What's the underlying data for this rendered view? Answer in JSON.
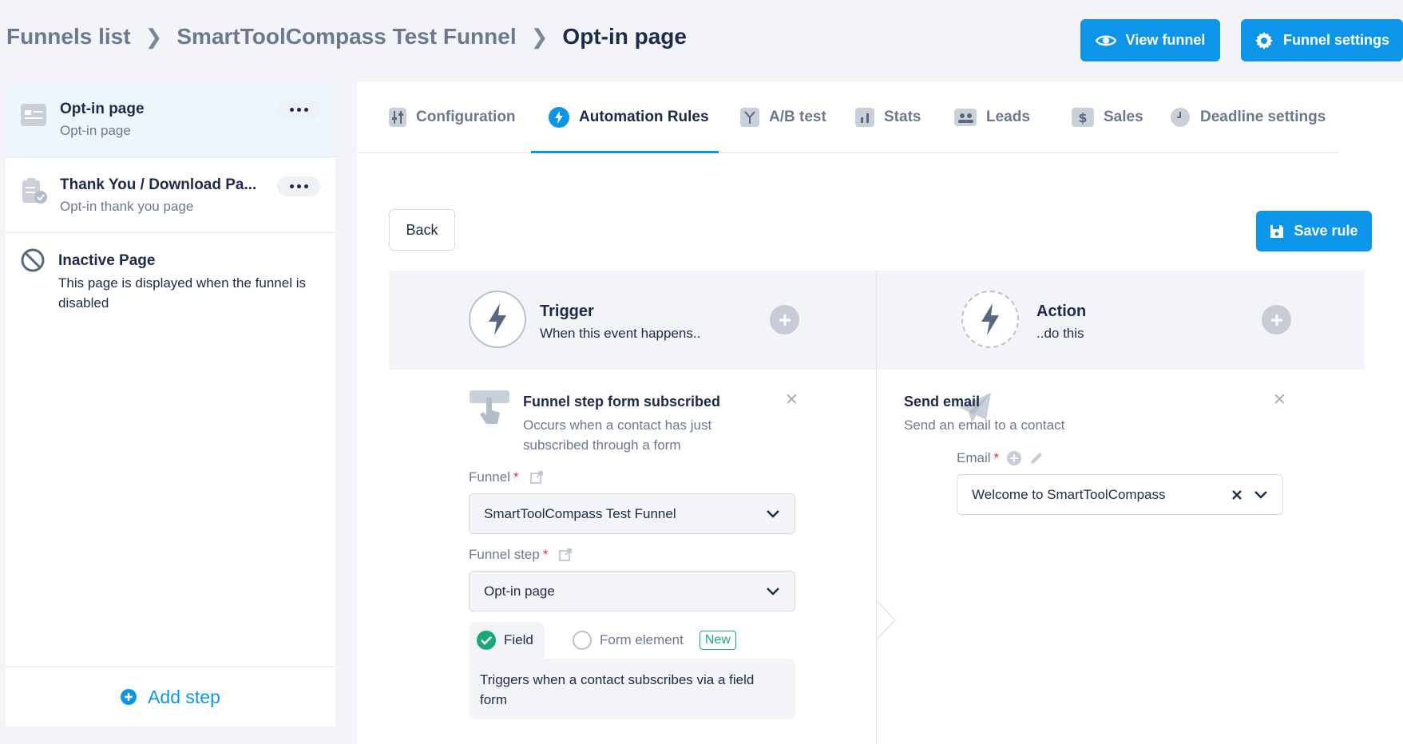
{
  "breadcrumb": {
    "root": "Funnels list",
    "funnel": "SmartToolCompass Test Funnel",
    "current": "Opt-in page"
  },
  "header": {
    "view_funnel": "View funnel",
    "funnel_settings": "Funnel settings"
  },
  "sidebar": {
    "items": [
      {
        "title": "Opt-in page",
        "subtitle": "Opt-in page"
      },
      {
        "title": "Thank You / Download Pa...",
        "subtitle": "Opt-in thank you page"
      },
      {
        "title": "Inactive Page",
        "subtitle": "This page is displayed when the funnel is disabled"
      }
    ],
    "add_step": "Add step"
  },
  "tabs": [
    {
      "label": "Configuration",
      "icon": "sliders-icon"
    },
    {
      "label": "Automation Rules",
      "icon": "bolt-icon"
    },
    {
      "label": "A/B test",
      "icon": "split-icon"
    },
    {
      "label": "Stats",
      "icon": "bar-chart-icon"
    },
    {
      "label": "Leads",
      "icon": "users-icon"
    },
    {
      "label": "Sales",
      "icon": "dollar-icon"
    },
    {
      "label": "Deadline settings",
      "icon": "clock-icon"
    }
  ],
  "rule": {
    "back": "Back",
    "save": "Save rule",
    "trigger": {
      "title": "Trigger",
      "subtitle": "When this event happens..",
      "card_title": "Funnel step form subscribed",
      "card_desc": "Occurs when a contact has just subscribed through a form",
      "funnel_label": "Funnel",
      "funnel_value": "SmartToolCompass Test Funnel",
      "step_label": "Funnel step",
      "step_value": "Opt-in page",
      "option_field": "Field",
      "option_form": "Form element",
      "badge_new": "New",
      "field_help": "Triggers when a contact subscribes via a field form"
    },
    "action": {
      "title": "Action",
      "subtitle": "..do this",
      "card_title": "Send email",
      "card_desc": "Send an email to a contact",
      "email_label": "Email",
      "email_value": "Welcome to SmartToolCompass"
    }
  },
  "colors": {
    "accent": "#0d95ea",
    "success": "#1aa877",
    "required": "#e0353f"
  }
}
